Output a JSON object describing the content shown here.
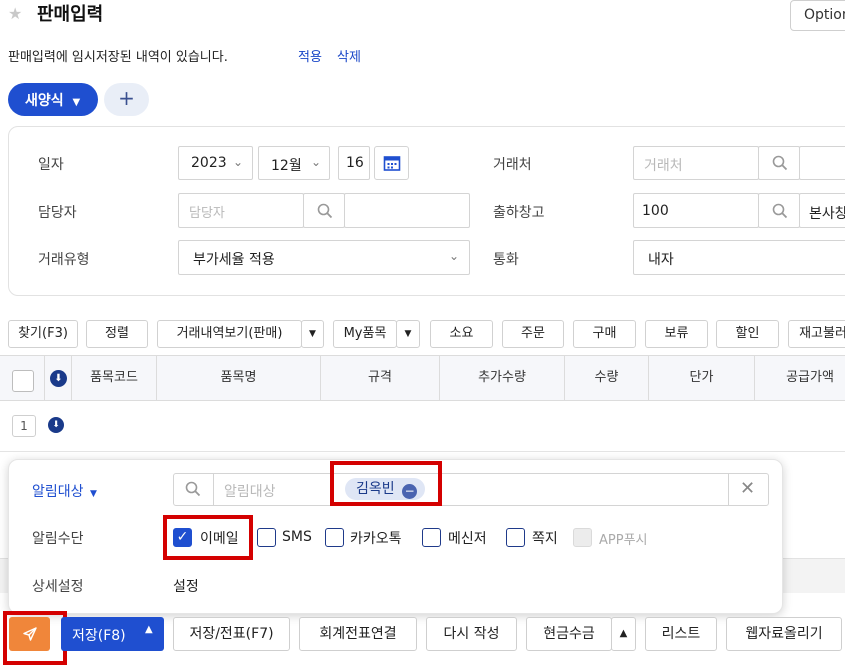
{
  "header": {
    "title": "판매입력",
    "option_button": "Option"
  },
  "notice": {
    "text": "판매입력에 임시저장된 내역이 있습니다.",
    "apply": "적용",
    "delete": "삭제"
  },
  "form_tabs": {
    "new_form": "새양식",
    "add": "+"
  },
  "form": {
    "date_label": "일자",
    "year": "2023",
    "month": "12월",
    "day": "16",
    "customer_label": "거래처",
    "customer_placeholder": "거래처",
    "manager_label": "담당자",
    "manager_placeholder": "담당자",
    "warehouse_label": "출하창고",
    "warehouse_value": "100",
    "warehouse_name": "본사창",
    "trade_type_label": "거래유형",
    "trade_type_value": "부가세율 적용",
    "currency_label": "통화",
    "currency_value": "내자"
  },
  "toolbar": {
    "find": "찾기(F3)",
    "sort": "정렬",
    "history": "거래내역보기(판매)",
    "my_items": "My품목",
    "demand": "소요",
    "order": "주문",
    "purchase": "구매",
    "hold": "보류",
    "discount": "할인",
    "stock": "재고불러"
  },
  "grid": {
    "columns": [
      "품목코드",
      "품목명",
      "규격",
      "추가수량",
      "수량",
      "단가",
      "공급가액"
    ],
    "row_number": "1"
  },
  "popup": {
    "target_label": "알림대상",
    "target_placeholder": "알림대상",
    "target_tag": "김옥빈",
    "method_label": "알림수단",
    "methods": {
      "email": "이메일",
      "sms": "SMS",
      "kakao": "카카오톡",
      "messenger": "메신저",
      "note": "쪽지",
      "app": "APP푸시"
    },
    "detail_label": "상세설정",
    "detail_link": "설정"
  },
  "bottom": {
    "save": "저장(F8)",
    "save_slip": "저장/전표(F7)",
    "link_slip": "회계전표연결",
    "rewrite": "다시 작성",
    "cash": "현금수금",
    "list": "리스트",
    "web_upload": "웹자료올리기"
  },
  "colors": {
    "primary": "#1f4fd0",
    "send_orange": "#f0863a",
    "highlight_red": "#d40000"
  }
}
